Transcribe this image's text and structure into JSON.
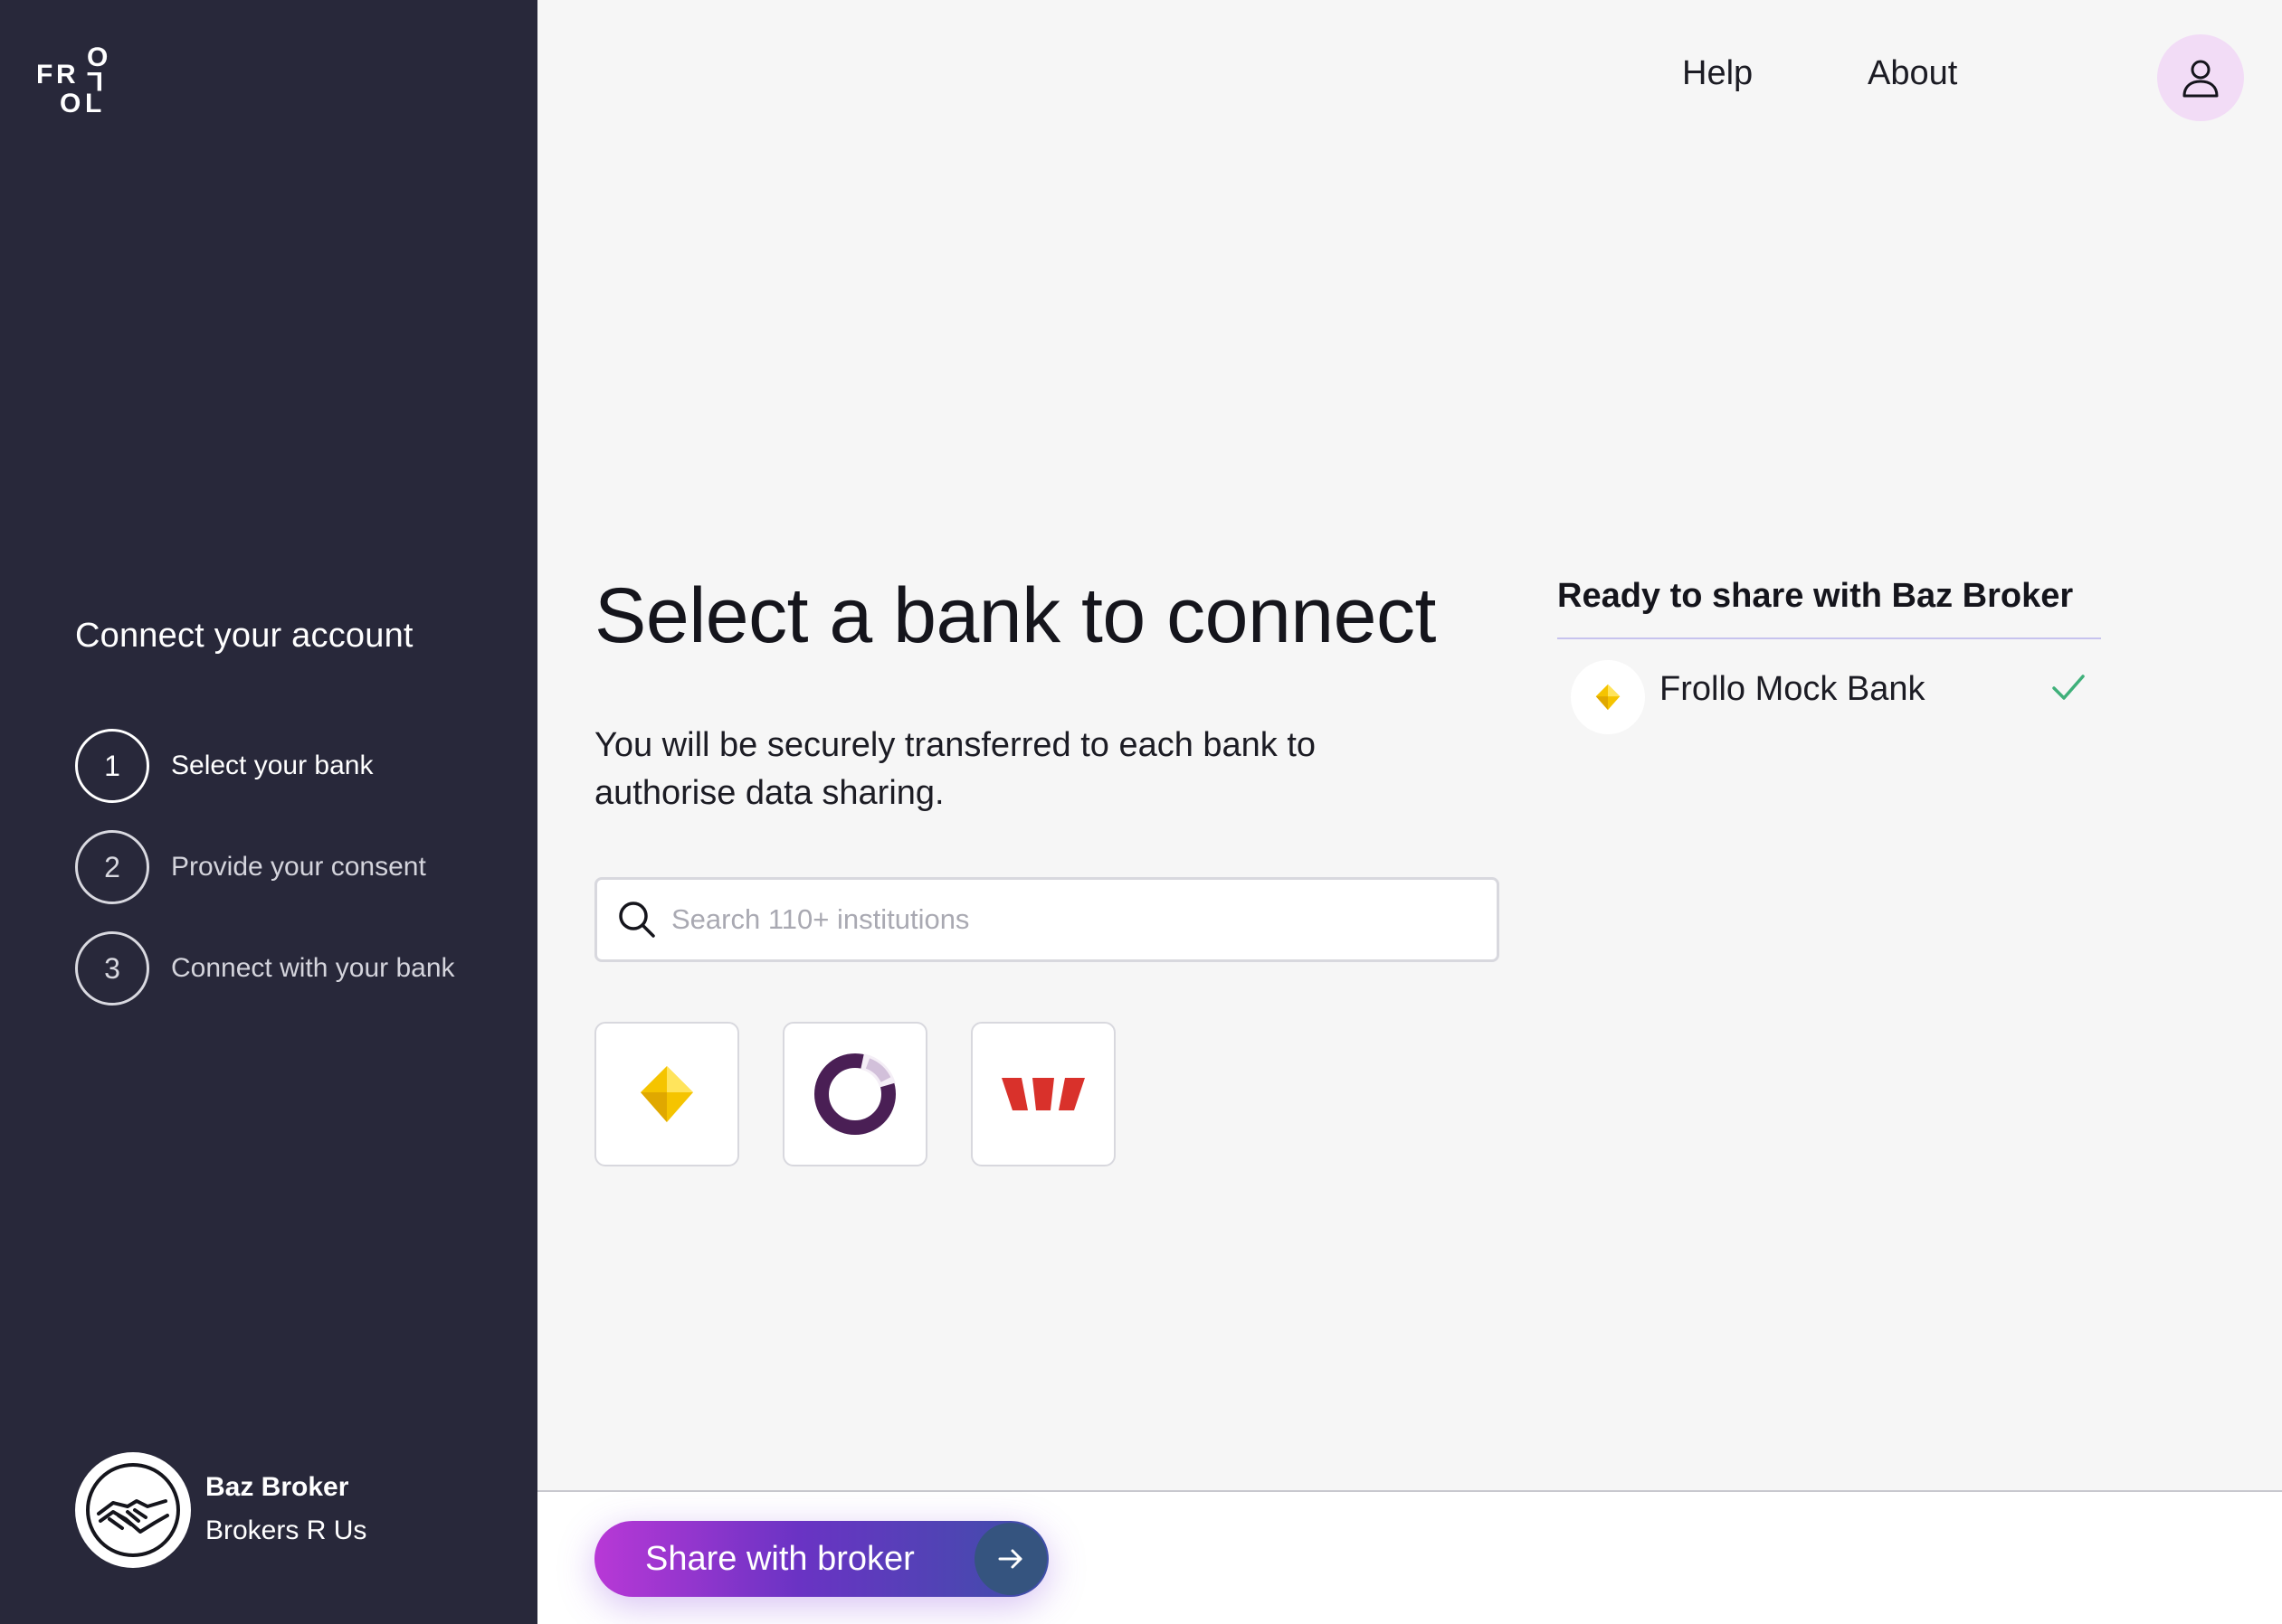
{
  "brand": {
    "logo_text": "FROLLO",
    "logo_letters": [
      "F",
      "R",
      "O",
      "O",
      "L",
      "L"
    ]
  },
  "sidebar": {
    "title": "Connect your account",
    "steps": [
      {
        "number": "1",
        "label": "Select your bank",
        "active": true
      },
      {
        "number": "2",
        "label": "Provide your consent",
        "active": false
      },
      {
        "number": "3",
        "label": "Connect with your bank",
        "active": false
      }
    ],
    "broker": {
      "name": "Baz Broker",
      "company": "Brokers R Us",
      "icon": "handshake-icon"
    }
  },
  "header": {
    "nav": [
      {
        "label": "Help"
      },
      {
        "label": "About"
      }
    ],
    "profile_icon": "user-icon"
  },
  "main": {
    "title": "Select a bank to connect",
    "subtitle": "You will be securely transferred to each bank to authorise data sharing.",
    "search": {
      "placeholder": "Search 110+ institutions",
      "value": "",
      "icon": "search-icon"
    },
    "banks": [
      {
        "icon": "yellow-diamond-bank-logo",
        "color": "#f5c400"
      },
      {
        "icon": "purple-ring-bank-logo",
        "color": "#4a1f55"
      },
      {
        "icon": "red-w-bank-logo",
        "color": "#d9312b"
      }
    ]
  },
  "ready_panel": {
    "title": "Ready to share with Baz Broker",
    "items": [
      {
        "name": "Frollo Mock Bank",
        "icon": "yellow-diamond-bank-logo",
        "status_icon": "check-icon"
      }
    ]
  },
  "footer": {
    "share_button_label": "Share with broker",
    "share_button_icon": "arrow-right-icon"
  },
  "colors": {
    "sidebar_bg": "#28283a",
    "page_bg": "#f6f6f6",
    "accent_gradient_start": "#b838d6",
    "accent_gradient_end": "#3e4fa9",
    "check_green": "#3fb07a",
    "profile_bg": "#f2dcf6"
  }
}
